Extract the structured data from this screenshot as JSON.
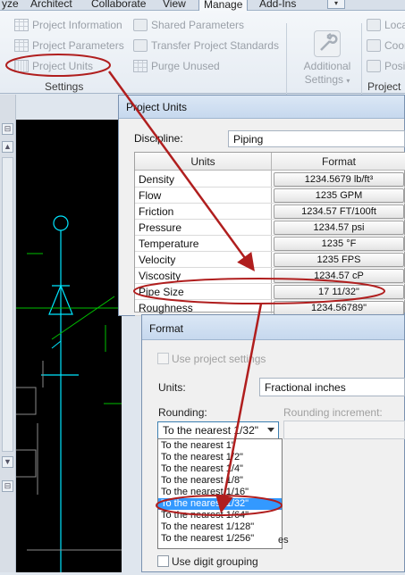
{
  "ribbon": {
    "tabs": [
      "yze",
      "Architect",
      "Collaborate",
      "View",
      "Manage",
      "Add-Ins"
    ],
    "active_tab": "Manage",
    "items": {
      "project_information": "Project Information",
      "project_parameters": "Project Parameters",
      "project_units": "Project Units",
      "shared_parameters": "Shared Parameters",
      "transfer_project_standards": "Transfer Project Standards",
      "purge_unused": "Purge Unused",
      "additional_settings_line1": "Additional",
      "additional_settings_line2": "Settings",
      "loca": "Loca",
      "coor": "Coor",
      "posit": "Posit"
    },
    "panel_settings": "Settings",
    "panel_project": "Project"
  },
  "project_units_dialog": {
    "title": "Project Units",
    "discipline_label": "Discipline:",
    "discipline_value": "Piping",
    "col_units": "Units",
    "col_format": "Format",
    "rows": [
      {
        "name": "Density",
        "format": "1234.5679 lb/ft³"
      },
      {
        "name": "Flow",
        "format": "1235 GPM"
      },
      {
        "name": "Friction",
        "format": "1234.57 FT/100ft"
      },
      {
        "name": "Pressure",
        "format": "1234.57 psi"
      },
      {
        "name": "Temperature",
        "format": "1235 °F"
      },
      {
        "name": "Velocity",
        "format": "1235 FPS"
      },
      {
        "name": "Viscosity",
        "format": "1234.57 cP"
      },
      {
        "name": "Pipe Size",
        "format": "17 11/32\""
      },
      {
        "name": "Roughness",
        "format": "1234.56789\""
      }
    ]
  },
  "format_dialog": {
    "title": "Format",
    "use_project_settings": "Use project settings",
    "units_label": "Units:",
    "units_value": "Fractional inches",
    "rounding_label": "Rounding:",
    "rounding_increment_label": "Rounding increment:",
    "rounding_value": "To the nearest 1/32\"",
    "rounding_options": [
      "To the nearest 1\"",
      "To the nearest 1/2\"",
      "To the nearest 1/4\"",
      "To the nearest 1/8\"",
      "To the nearest 1/16\"",
      "To the nearest 1/32\"",
      "To the nearest 1/64\"",
      "To the nearest 1/128\"",
      "To the nearest 1/256\""
    ],
    "selected_option_index": 5,
    "partial_label_tail": "es",
    "use_digit_grouping": "Use digit grouping"
  },
  "colors": {
    "annotation": "#b01e1e",
    "selection": "#3399ff",
    "drawing_bg": "#000000",
    "cad_cyan": "#00e5ff",
    "cad_green": "#00c000"
  }
}
